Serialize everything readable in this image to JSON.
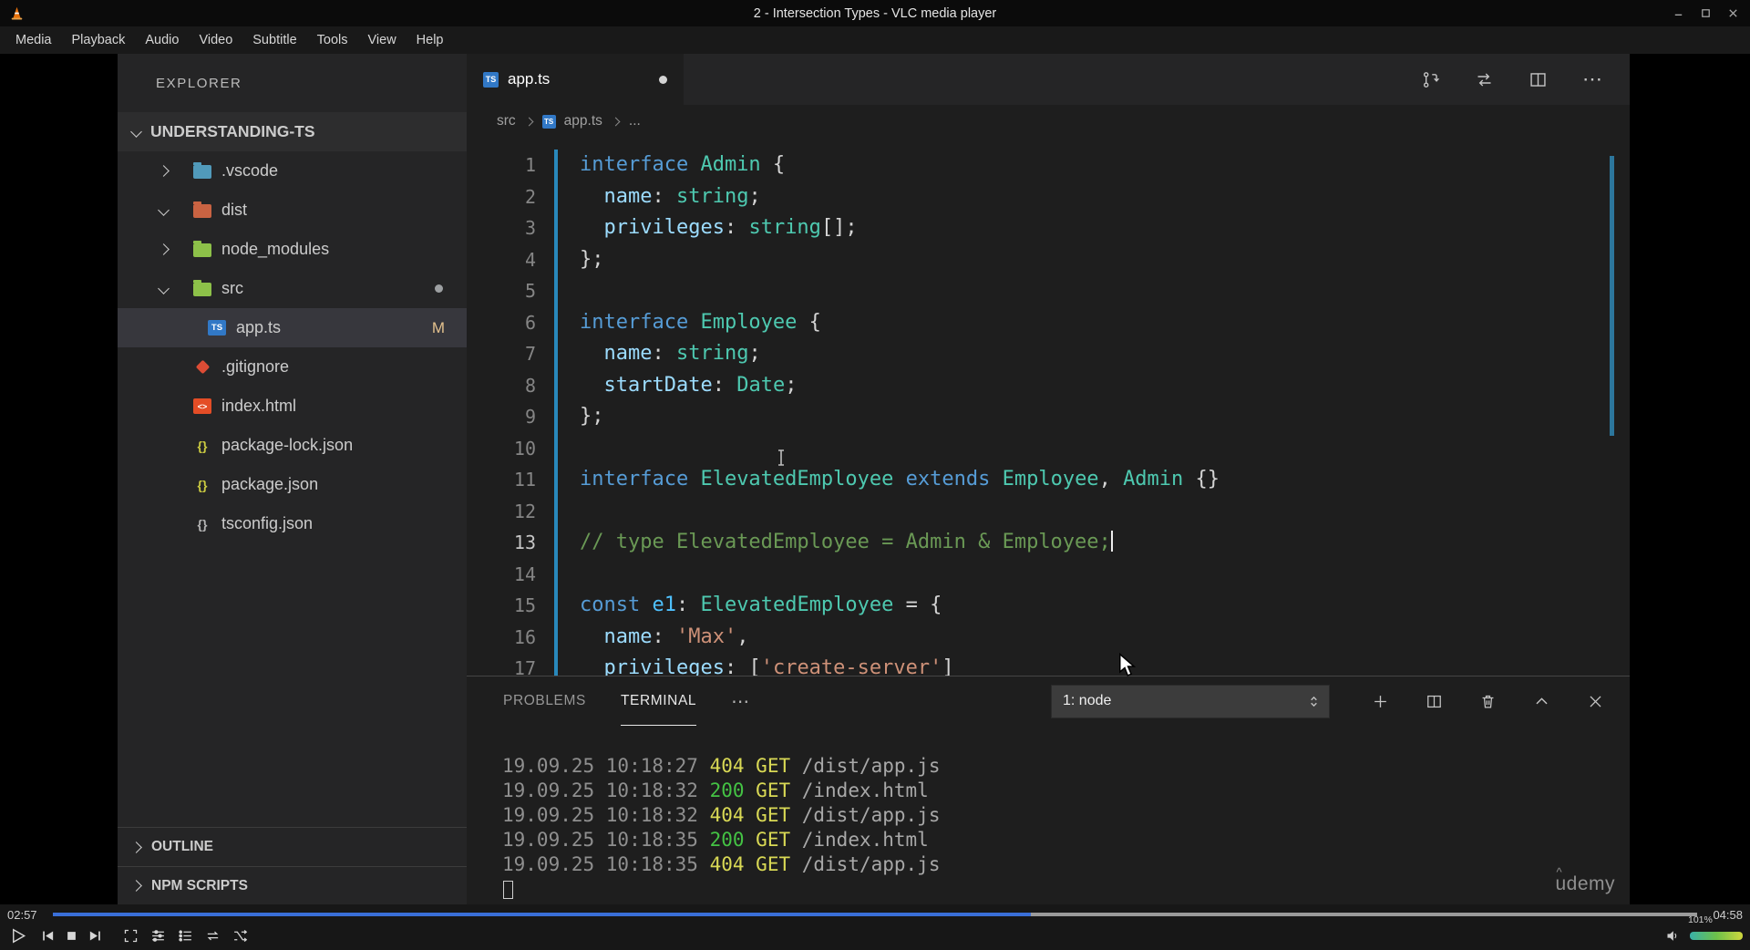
{
  "window": {
    "title": "2 - Intersection Types - VLC media player",
    "menu": [
      "Media",
      "Playback",
      "Audio",
      "Video",
      "Subtitle",
      "Tools",
      "View",
      "Help"
    ]
  },
  "player": {
    "elapsed": "02:57",
    "duration": "04:58",
    "progress_pct": 59.5,
    "volume": "101%"
  },
  "palette": {
    "code": {
      "kw": "#569cd6",
      "type": "#4ec9b0",
      "prop": "#9cdcfe",
      "def": "#d4d4d4",
      "cmt": "#6a9955",
      "str": "#ce9178",
      "var": "#4fc1ff"
    },
    "term": {
      "ts": "#8f8f8f",
      "err": "#d9d955",
      "ok": "#44c344",
      "get": "#d9d955",
      "path": "#a8a8a8"
    }
  },
  "vscode": {
    "explorer": {
      "header": "EXPLORER",
      "root": "UNDERSTANDING-TS",
      "items": [
        {
          "label": ".vscode",
          "icon": "folder",
          "color": "#519aba",
          "chevron": "right",
          "level": 1
        },
        {
          "label": "dist",
          "icon": "folder",
          "color": "#c96342",
          "chevron": "down",
          "level": 1
        },
        {
          "label": "node_modules",
          "icon": "folder",
          "color": "#8dc149",
          "chevron": "right",
          "level": 1
        },
        {
          "label": "src",
          "icon": "folder",
          "color": "#8dc149",
          "chevron": "down",
          "level": 1,
          "dot": true
        },
        {
          "label": "app.ts",
          "icon": "ts",
          "color": "#3178c6",
          "level": 2,
          "selected": true,
          "badge": "M"
        },
        {
          "label": ".gitignore",
          "icon": "git",
          "color": "#dd4c35",
          "level": 1
        },
        {
          "label": "index.html",
          "icon": "html",
          "color": "#e44d26",
          "level": 1
        },
        {
          "label": "package-lock.json",
          "icon": "json",
          "color": "#cbcb41",
          "level": 1
        },
        {
          "label": "package.json",
          "icon": "json",
          "color": "#cbcb41",
          "level": 1
        },
        {
          "label": "tsconfig.json",
          "icon": "config",
          "color": "#b5b5b5",
          "level": 1
        }
      ],
      "sections": [
        {
          "label": "OUTLINE"
        },
        {
          "label": "NPM SCRIPTS"
        }
      ]
    },
    "editor": {
      "tab": {
        "label": "app.ts"
      },
      "breadcrumb": {
        "folder": "src",
        "file": "app.ts",
        "more": "..."
      },
      "lines": [
        {
          "n": 1,
          "tokens": [
            {
              "t": "interface ",
              "c": "kw"
            },
            {
              "t": "Admin",
              "c": "type"
            },
            {
              "t": " {",
              "c": "def"
            }
          ]
        },
        {
          "n": 2,
          "tokens": [
            {
              "t": "  ",
              "c": "def"
            },
            {
              "t": "name",
              "c": "prop"
            },
            {
              "t": ": ",
              "c": "def"
            },
            {
              "t": "string",
              "c": "type"
            },
            {
              "t": ";",
              "c": "def"
            }
          ]
        },
        {
          "n": 3,
          "tokens": [
            {
              "t": "  ",
              "c": "def"
            },
            {
              "t": "privileges",
              "c": "prop"
            },
            {
              "t": ": ",
              "c": "def"
            },
            {
              "t": "string",
              "c": "type"
            },
            {
              "t": "[];",
              "c": "def"
            }
          ]
        },
        {
          "n": 4,
          "tokens": [
            {
              "t": "};",
              "c": "def"
            }
          ]
        },
        {
          "n": 5,
          "tokens": []
        },
        {
          "n": 6,
          "tokens": [
            {
              "t": "interface ",
              "c": "kw"
            },
            {
              "t": "Employee",
              "c": "type"
            },
            {
              "t": " {",
              "c": "def"
            }
          ]
        },
        {
          "n": 7,
          "tokens": [
            {
              "t": "  ",
              "c": "def"
            },
            {
              "t": "name",
              "c": "prop"
            },
            {
              "t": ": ",
              "c": "def"
            },
            {
              "t": "string",
              "c": "type"
            },
            {
              "t": ";",
              "c": "def"
            }
          ]
        },
        {
          "n": 8,
          "tokens": [
            {
              "t": "  ",
              "c": "def"
            },
            {
              "t": "startDate",
              "c": "prop"
            },
            {
              "t": ": ",
              "c": "def"
            },
            {
              "t": "Date",
              "c": "type"
            },
            {
              "t": ";",
              "c": "def"
            }
          ]
        },
        {
          "n": 9,
          "tokens": [
            {
              "t": "};",
              "c": "def"
            }
          ]
        },
        {
          "n": 10,
          "tokens": []
        },
        {
          "n": 11,
          "tokens": [
            {
              "t": "interface ",
              "c": "kw"
            },
            {
              "t": "ElevatedEmployee",
              "c": "type"
            },
            {
              "t": " extends ",
              "c": "kw"
            },
            {
              "t": "Employee",
              "c": "type"
            },
            {
              "t": ", ",
              "c": "def"
            },
            {
              "t": "Admin",
              "c": "type"
            },
            {
              "t": " {}",
              "c": "def"
            }
          ]
        },
        {
          "n": 12,
          "tokens": []
        },
        {
          "n": 13,
          "active": true,
          "cursor": true,
          "tokens": [
            {
              "t": "// type ElevatedEmployee = Admin & Employee;",
              "c": "cmt"
            }
          ]
        },
        {
          "n": 14,
          "tokens": []
        },
        {
          "n": 15,
          "tokens": [
            {
              "t": "const ",
              "c": "kw"
            },
            {
              "t": "e1",
              "c": "var"
            },
            {
              "t": ": ",
              "c": "def"
            },
            {
              "t": "ElevatedEmployee",
              "c": "type"
            },
            {
              "t": " = {",
              "c": "def"
            }
          ]
        },
        {
          "n": 16,
          "tokens": [
            {
              "t": "  ",
              "c": "def"
            },
            {
              "t": "name",
              "c": "prop"
            },
            {
              "t": ": ",
              "c": "def"
            },
            {
              "t": "'Max'",
              "c": "str"
            },
            {
              "t": ",",
              "c": "def"
            }
          ]
        },
        {
          "n": 17,
          "tokens": [
            {
              "t": "  ",
              "c": "def"
            },
            {
              "t": "privileges",
              "c": "prop"
            },
            {
              "t": ": [",
              "c": "def"
            },
            {
              "t": "'create-server'",
              "c": "str"
            },
            {
              "t": "]",
              "c": "def"
            }
          ]
        }
      ]
    },
    "terminal": {
      "problems_label": "PROBLEMS",
      "terminal_label": "TERMINAL",
      "more": "⋯",
      "dropdown": "1: node",
      "lines": [
        [
          {
            "t": "19.09.25 10:18:27 ",
            "c": "ts"
          },
          {
            "t": "404",
            "c": "err"
          },
          {
            "t": " ",
            "c": "ts"
          },
          {
            "t": "GET",
            "c": "get"
          },
          {
            "t": " /dist/app.js",
            "c": "path"
          }
        ],
        [
          {
            "t": "19.09.25 10:18:32 ",
            "c": "ts"
          },
          {
            "t": "200",
            "c": "ok"
          },
          {
            "t": " ",
            "c": "ts"
          },
          {
            "t": "GET",
            "c": "get"
          },
          {
            "t": " /index.html",
            "c": "path"
          }
        ],
        [
          {
            "t": "19.09.25 10:18:32 ",
            "c": "ts"
          },
          {
            "t": "404",
            "c": "err"
          },
          {
            "t": " ",
            "c": "ts"
          },
          {
            "t": "GET",
            "c": "get"
          },
          {
            "t": " /dist/app.js",
            "c": "path"
          }
        ],
        [
          {
            "t": "19.09.25 10:18:35 ",
            "c": "ts"
          },
          {
            "t": "200",
            "c": "ok"
          },
          {
            "t": " ",
            "c": "ts"
          },
          {
            "t": "GET",
            "c": "get"
          },
          {
            "t": " /index.html",
            "c": "path"
          }
        ],
        [
          {
            "t": "19.09.25 10:18:35 ",
            "c": "ts"
          },
          {
            "t": "404",
            "c": "err"
          },
          {
            "t": " ",
            "c": "ts"
          },
          {
            "t": "GET",
            "c": "get"
          },
          {
            "t": " /dist/app.js",
            "c": "path"
          }
        ]
      ]
    },
    "watermark": "udemy"
  }
}
